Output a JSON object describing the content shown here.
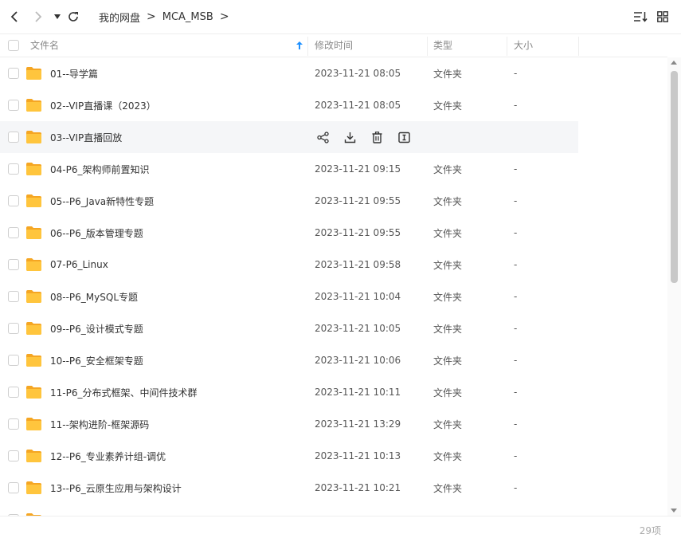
{
  "breadcrumb": [
    "我的网盘",
    "MCA_MSB"
  ],
  "breadcrumb_sep": ">",
  "columns": {
    "name": "文件名",
    "time": "修改时间",
    "type": "类型",
    "size": "大小"
  },
  "rows": [
    {
      "name": "01--导学篇",
      "time": "2023-11-21 08:05",
      "type": "文件夹",
      "size": "-"
    },
    {
      "name": "02--VIP直播课（2023）",
      "time": "2023-11-21 08:05",
      "type": "文件夹",
      "size": "-"
    },
    {
      "name": "03--VIP直播回放",
      "time": "",
      "type": "",
      "size": "",
      "hovered": true
    },
    {
      "name": "04-P6_架构师前置知识",
      "time": "2023-11-21 09:15",
      "type": "文件夹",
      "size": "-"
    },
    {
      "name": "05--P6_Java新特性专题",
      "time": "2023-11-21 09:55",
      "type": "文件夹",
      "size": "-"
    },
    {
      "name": "06--P6_版本管理专题",
      "time": "2023-11-21 09:55",
      "type": "文件夹",
      "size": "-"
    },
    {
      "name": "07-P6_Linux",
      "time": "2023-11-21 09:58",
      "type": "文件夹",
      "size": "-"
    },
    {
      "name": "08--P6_MySQL专题",
      "time": "2023-11-21 10:04",
      "type": "文件夹",
      "size": "-"
    },
    {
      "name": "09--P6_设计模式专题",
      "time": "2023-11-21 10:05",
      "type": "文件夹",
      "size": "-"
    },
    {
      "name": "10--P6_安全框架专题",
      "time": "2023-11-21 10:06",
      "type": "文件夹",
      "size": "-"
    },
    {
      "name": "11-P6_分布式框架、中间件技术群",
      "time": "2023-11-21 10:11",
      "type": "文件夹",
      "size": "-"
    },
    {
      "name": "11--架构进阶-框架源码",
      "time": "2023-11-21 13:29",
      "type": "文件夹",
      "size": "-"
    },
    {
      "name": "12--P6_专业素养计组-调优",
      "time": "2023-11-21 10:13",
      "type": "文件夹",
      "size": "-"
    },
    {
      "name": "13--P6_云原生应用与架构设计",
      "time": "2023-11-21 10:21",
      "type": "文件夹",
      "size": "-"
    },
    {
      "name": "",
      "time": "",
      "type": "",
      "size": ""
    }
  ],
  "hover_actions": [
    "share-icon",
    "download-icon",
    "delete-icon",
    "rename-icon"
  ],
  "footer": {
    "count": "29项"
  },
  "colors": {
    "folder": "#FFC53D",
    "folder_dark": "#F5A623",
    "sort_arrow": "#1E90FF",
    "hover_row": "#f5f6f8"
  },
  "icons": [
    "back-icon",
    "forward-icon",
    "dropdown-icon",
    "refresh-icon",
    "sort-icon",
    "grid-view-icon",
    "sort-ascending-icon"
  ]
}
